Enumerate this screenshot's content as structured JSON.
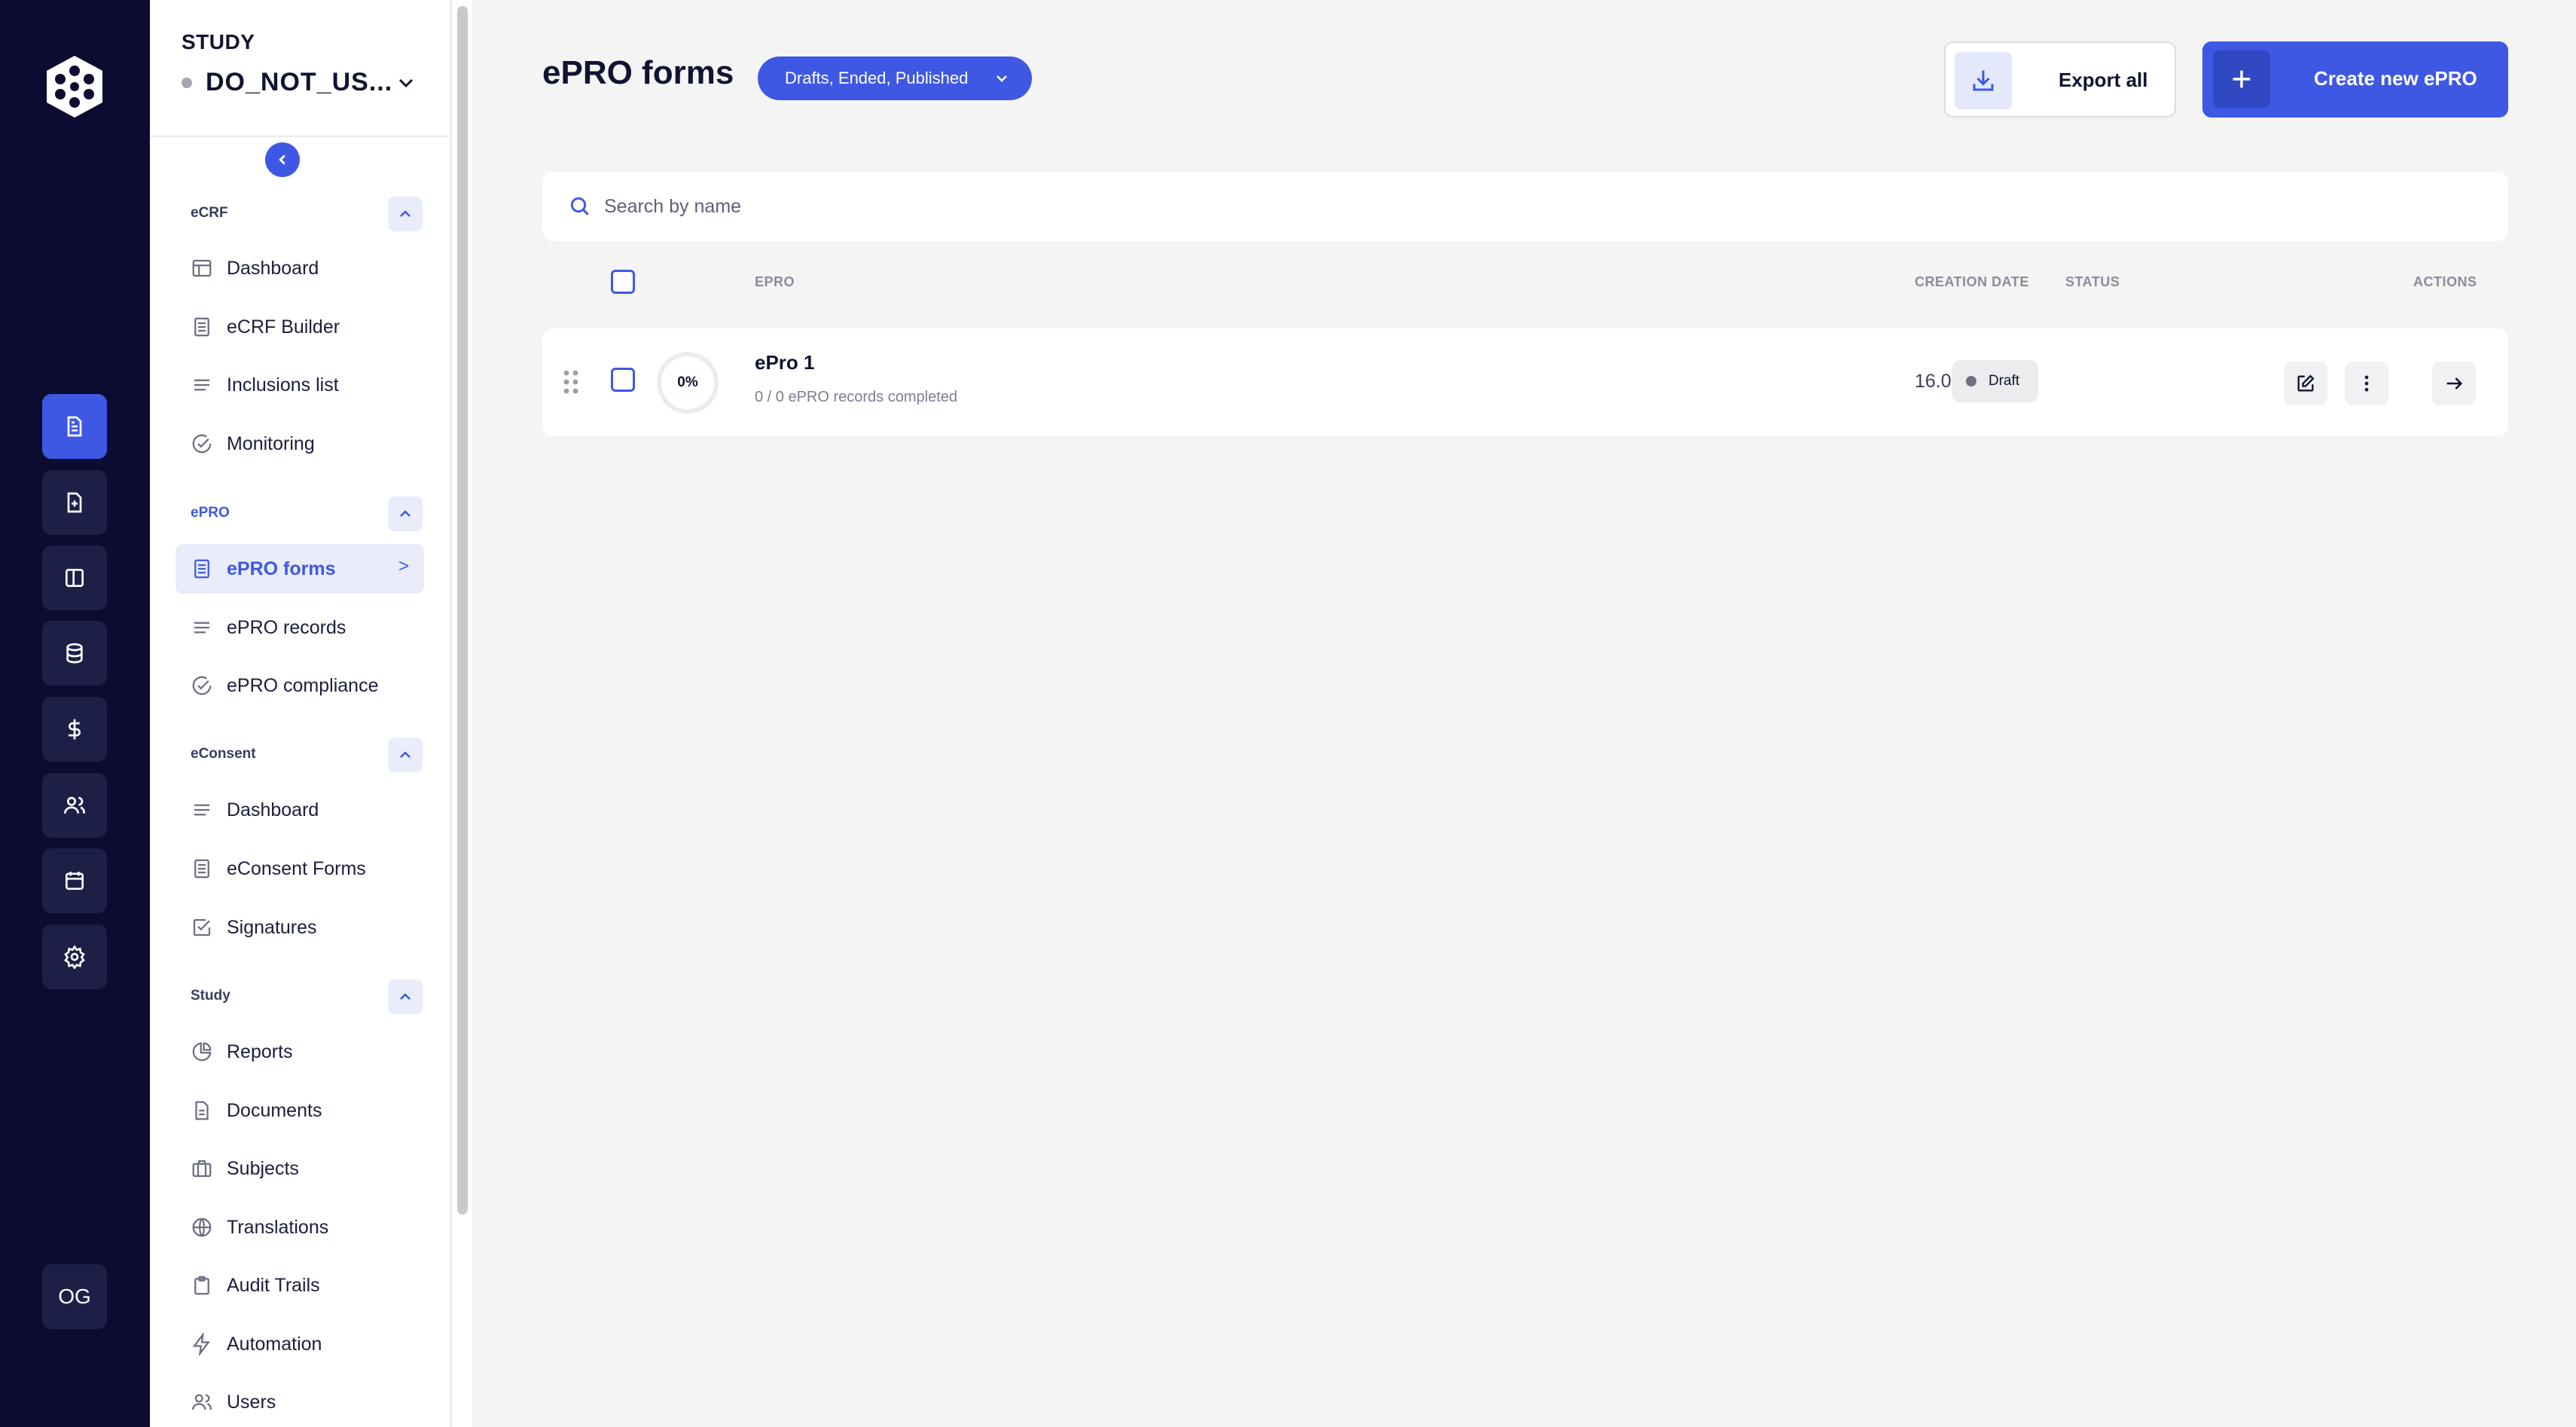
{
  "rail": {
    "logo_icon": "hexagon-logo-icon",
    "items": [
      {
        "icon": "document-icon",
        "active": true
      },
      {
        "icon": "file-plus-icon",
        "active": false
      },
      {
        "icon": "columns-icon",
        "active": false
      },
      {
        "icon": "database-icon",
        "active": false
      },
      {
        "icon": "dollar-icon",
        "active": false
      },
      {
        "icon": "users-icon",
        "active": false
      },
      {
        "icon": "calendar-icon",
        "active": false
      },
      {
        "icon": "gear-icon",
        "active": false
      }
    ],
    "avatar_initials": "OG"
  },
  "nav": {
    "study_label": "STUDY",
    "study_name": "DO_NOT_US...",
    "sections": [
      {
        "title": "eCRF",
        "items": [
          {
            "label": "Dashboard",
            "icon": "layout-icon"
          },
          {
            "label": "eCRF Builder",
            "icon": "form-icon"
          },
          {
            "label": "Inclusions list",
            "icon": "lines-icon"
          },
          {
            "label": "Monitoring",
            "icon": "check-circle-icon"
          }
        ]
      },
      {
        "title": "ePRO",
        "items": [
          {
            "label": "ePRO forms",
            "icon": "form-icon",
            "active": true,
            "arrow": ">"
          },
          {
            "label": "ePRO records",
            "icon": "lines-icon"
          },
          {
            "label": "ePRO compliance",
            "icon": "check-circle-icon"
          }
        ]
      },
      {
        "title": "eConsent",
        "items": [
          {
            "label": "Dashboard",
            "icon": "lines-icon"
          },
          {
            "label": "eConsent Forms",
            "icon": "form-icon"
          },
          {
            "label": "Signatures",
            "icon": "check-square-icon"
          }
        ]
      },
      {
        "title": "Study",
        "items": [
          {
            "label": "Reports",
            "icon": "pie-icon"
          },
          {
            "label": "Documents",
            "icon": "file-icon"
          },
          {
            "label": "Subjects",
            "icon": "briefcase-icon"
          },
          {
            "label": "Translations",
            "icon": "globe-icon"
          },
          {
            "label": "Audit Trails",
            "icon": "clipboard-icon"
          },
          {
            "label": "Automation",
            "icon": "bolt-icon"
          },
          {
            "label": "Users",
            "icon": "users-icon"
          }
        ]
      }
    ]
  },
  "main": {
    "title": "ePRO forms",
    "filter_label": "Drafts, Ended, Published",
    "export_label": "Export all",
    "create_label": "Create new ePRO",
    "search_placeholder": "Search by name",
    "columns": {
      "epro": "EPRO",
      "creation_date": "CREATION DATE",
      "status": "STATUS",
      "actions": "ACTIONS"
    },
    "rows": [
      {
        "name": "ePro 1",
        "progress_label": "0%",
        "progress": 0,
        "records_text": "0 / 0 ePRO records completed",
        "creation_date": "16.07.2025",
        "status": "Draft"
      }
    ]
  },
  "colors": {
    "accent": "#3f58e3",
    "rail_bg": "#0c0c33",
    "page_bg": "#f4f4f4"
  }
}
